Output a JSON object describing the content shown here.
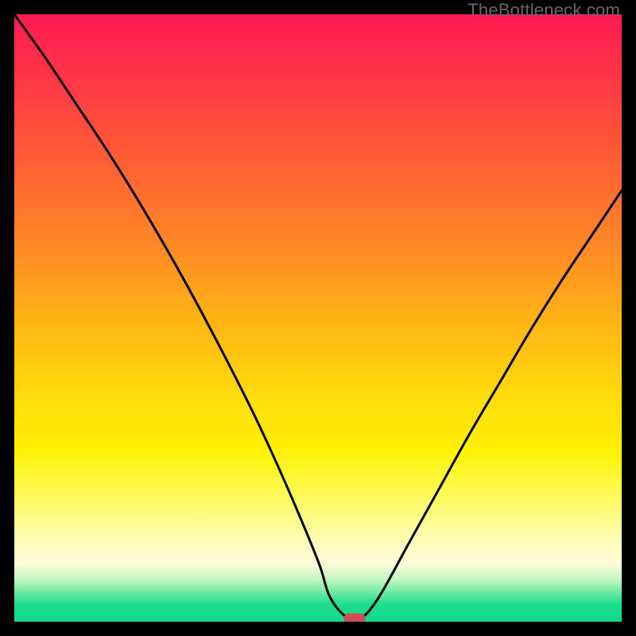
{
  "watermark": "TheBottleneck.com",
  "colors": {
    "frame": "#000000",
    "curve_stroke": "#000000",
    "marker": "#cf4f57",
    "gradient_stops": [
      {
        "offset": 0.0,
        "color": "#ff1b52"
      },
      {
        "offset": 0.12,
        "color": "#ff3a45"
      },
      {
        "offset": 0.25,
        "color": "#ff6133"
      },
      {
        "offset": 0.38,
        "color": "#ff8826"
      },
      {
        "offset": 0.5,
        "color": "#ffb216"
      },
      {
        "offset": 0.62,
        "color": "#ffd90c"
      },
      {
        "offset": 0.72,
        "color": "#fff205"
      },
      {
        "offset": 0.8,
        "color": "#fffb62"
      },
      {
        "offset": 0.86,
        "color": "#fffcb0"
      },
      {
        "offset": 0.905,
        "color": "#fdfbdb"
      },
      {
        "offset": 0.93,
        "color": "#c3f6c3"
      },
      {
        "offset": 0.952,
        "color": "#6de9a2"
      },
      {
        "offset": 0.972,
        "color": "#1ddd8f"
      },
      {
        "offset": 1.0,
        "color": "#13d98b"
      }
    ]
  },
  "chart_data": {
    "type": "line",
    "title": "",
    "xlabel": "",
    "ylabel": "",
    "xlim": [
      0,
      100
    ],
    "ylim": [
      0,
      100
    ],
    "grid": false,
    "legend": false,
    "series": [
      {
        "name": "bottleneck-curve",
        "x": [
          0,
          5,
          10,
          15,
          20,
          25,
          30,
          35,
          40,
          45,
          50,
          52,
          55,
          57,
          60,
          65,
          70,
          75,
          80,
          85,
          90,
          95,
          100
        ],
        "y": [
          100,
          93,
          85.5,
          78,
          70,
          61.5,
          52.5,
          43,
          33,
          22,
          10,
          4,
          0.5,
          0.5,
          4,
          13,
          22,
          31,
          39.5,
          48,
          56,
          63.5,
          71
        ]
      }
    ],
    "marker": {
      "x": 56,
      "y": 0.5
    }
  }
}
